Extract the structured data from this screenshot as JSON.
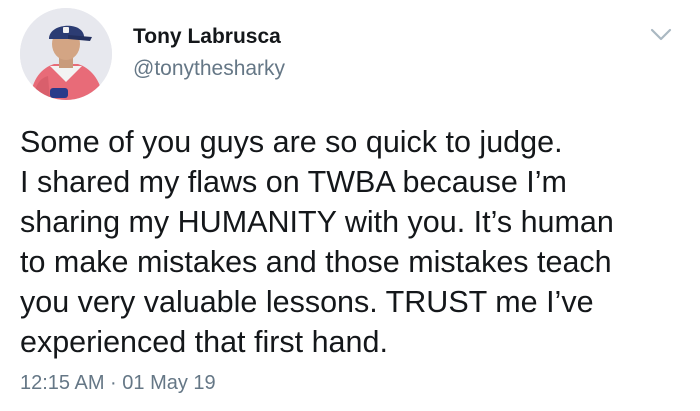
{
  "tweet": {
    "author": {
      "name": "Tony Labrusca",
      "handle": "@tonythesharky",
      "avatar_icon": "avatar-photo"
    },
    "menu_icon": "chevron-down-icon",
    "text_lines": [
      "Some of you guys are so quick to judge.",
      "I shared my flaws on TWBA because I’m",
      "sharing my HUMANITY with you. It’s human",
      "to make mistakes and those mistakes teach",
      "you very valuable lessons. TRUST me I’ve",
      "experienced that first hand."
    ],
    "timestamp": "12:15 AM · 01 May 19"
  },
  "colors": {
    "text": "#14171a",
    "secondary": "#657786",
    "background": "#ffffff"
  }
}
